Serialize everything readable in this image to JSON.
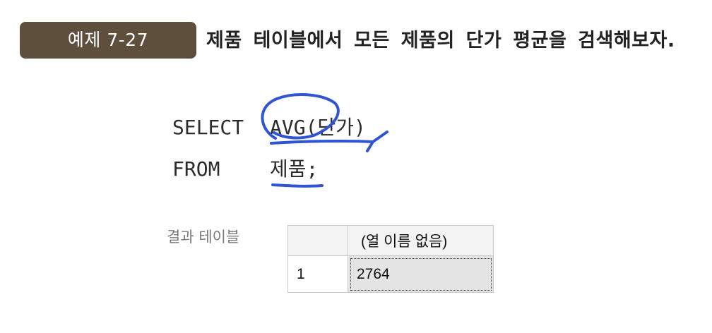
{
  "example": {
    "badge": "예제 7-27",
    "title": "제품 테이블에서 모든 제품의 단가 평균을 검색해보자."
  },
  "sql": {
    "line1_keyword": "SELECT",
    "line1_arg": "AVG(단가)",
    "line2_keyword": "FROM",
    "line2_arg": "제품;"
  },
  "result": {
    "label": "결과 테이블",
    "column_header": "(열 이름 없음)",
    "rows": [
      {
        "num": "1",
        "value": "2764"
      }
    ]
  },
  "annotation": {
    "ink_color": "#2f55d4"
  }
}
